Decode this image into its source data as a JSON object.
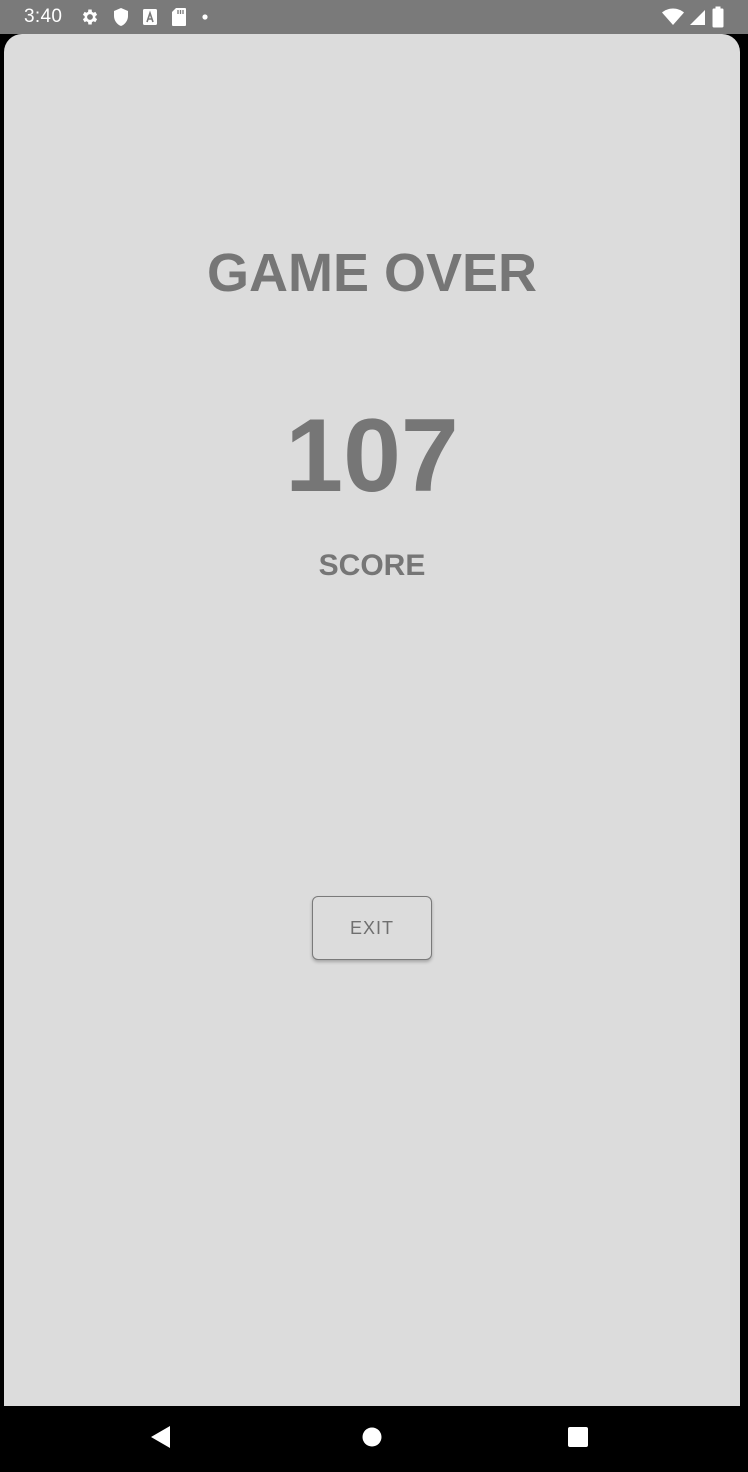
{
  "status_bar": {
    "time": "3:40",
    "left_icons": [
      "gear-icon",
      "shield-icon",
      "font-a-icon",
      "sd-card-icon",
      "dot-icon"
    ],
    "right_icons": [
      "wifi-icon",
      "cell-signal-icon",
      "battery-icon"
    ],
    "background": "#7a7a7a"
  },
  "game_over": {
    "title": "GAME OVER",
    "score_value": "107",
    "score_label": "SCORE",
    "exit_label": "EXIT",
    "text_color": "#767676",
    "background": "#dcdcdc"
  },
  "nav_bar": {
    "buttons": [
      "back-icon",
      "home-icon",
      "recents-icon"
    ]
  }
}
